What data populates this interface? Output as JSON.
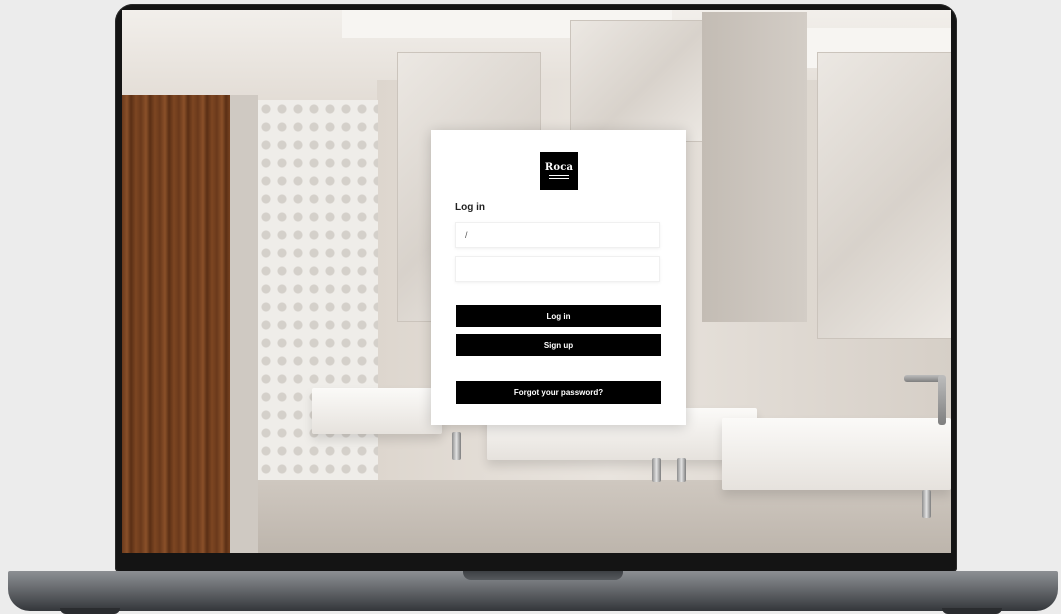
{
  "login": {
    "logo_text": "Roca",
    "title": "Log in",
    "username_value": "/",
    "password_value": "",
    "login_label": "Log in",
    "signup_label": "Sign up",
    "forgot_label": "Forgot your password?"
  },
  "colors": {
    "button_bg": "#000000",
    "card_bg": "#ffffff",
    "laptop_bezel": "#141414"
  }
}
